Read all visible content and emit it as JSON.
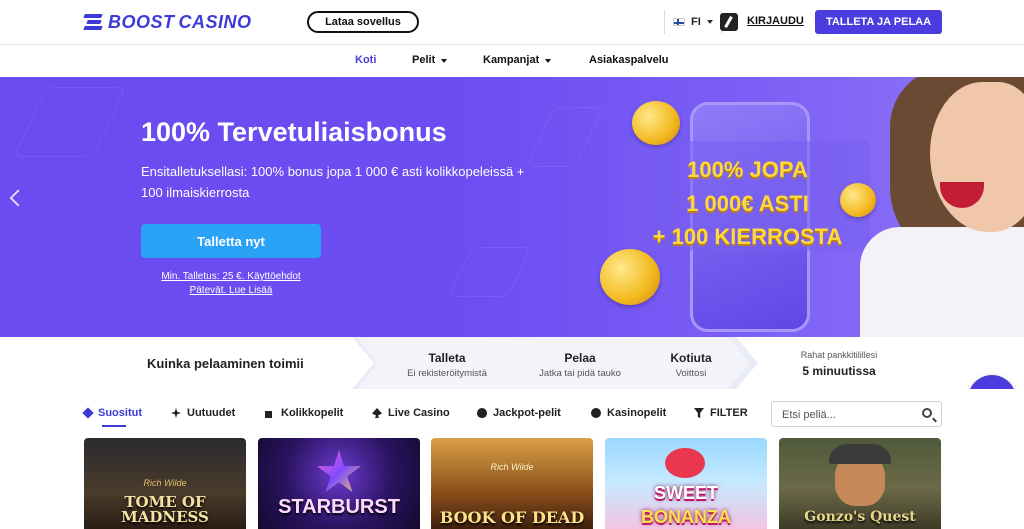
{
  "header": {
    "logo_boost": "BOOST",
    "logo_casino": "CASINO",
    "app_button": "Lataa sovellus",
    "language": "FI",
    "login": "KIRJAUDU",
    "deposit_play": "TALLETA JA PELAA"
  },
  "nav": {
    "items": [
      {
        "label": "Koti",
        "active": true
      },
      {
        "label": "Pelit",
        "dropdown": true
      },
      {
        "label": "Kampanjat",
        "dropdown": true
      },
      {
        "label": "Asiakaspalvelu"
      }
    ]
  },
  "hero": {
    "title": "100% Tervetuliaisbonus",
    "description": "Ensitalletuksellasi: 100% bonus jopa 1 000 € asti kolikkopeleissä + 100 ilmaiskierrosta",
    "cta": "Talletta nyt",
    "terms_line1": "Min. Talletus: 25 €. Käyttöehdot",
    "terms_line2": "Pätevät. Lue Lisää",
    "promo_line1": "100% JOPA",
    "promo_line2": "1 000€ ASTI",
    "promo_line3": "+ 100 KIERROSTA"
  },
  "steps": {
    "how": "Kuinka pelaaminen toimii",
    "items": [
      {
        "title": "Talleta",
        "sub": "Ei rekisteröitymistä"
      },
      {
        "title": "Pelaa",
        "sub": "Jatka tai pidä tauko"
      },
      {
        "title": "Kotiuta",
        "sub": "Voittosi"
      }
    ],
    "payout_sub": "Rahat pankkitilillesi",
    "payout_title": "5 minuutissa"
  },
  "categories": {
    "items": [
      {
        "label": "Suositut",
        "icon": "star-tag-icon",
        "active": true
      },
      {
        "label": "Uutuudet",
        "icon": "sparkle-icon"
      },
      {
        "label": "Kolikkopelit",
        "icon": "slot-lever-icon"
      },
      {
        "label": "Live Casino",
        "icon": "spade-icon"
      },
      {
        "label": "Jackpot-pelit",
        "icon": "money-bag-icon"
      },
      {
        "label": "Kasinopelit",
        "icon": "roulette-icon"
      },
      {
        "label": "FILTER",
        "icon": "filter-icon"
      }
    ],
    "search_placeholder": "Etsi peliä..."
  },
  "games": [
    {
      "name": "Tome of Madness",
      "label_top": "Rich Wilde",
      "label": "TOME OF MADNESS"
    },
    {
      "name": "Starburst",
      "label": "STARBURST"
    },
    {
      "name": "Book of Dead",
      "label_top": "Rich Wilde",
      "label": "BOOK OF DEAD"
    },
    {
      "name": "Sweet Bonanza",
      "label_top": "SWEET",
      "label": "BONANZA"
    },
    {
      "name": "Gonzo's Quest",
      "label": "Gonzo's Quest"
    }
  ],
  "colors": {
    "accent": "#4b3ce0",
    "hero": "#6a4cf0",
    "cta": "#2aa2f5",
    "promo_text": "#ffd83a"
  }
}
